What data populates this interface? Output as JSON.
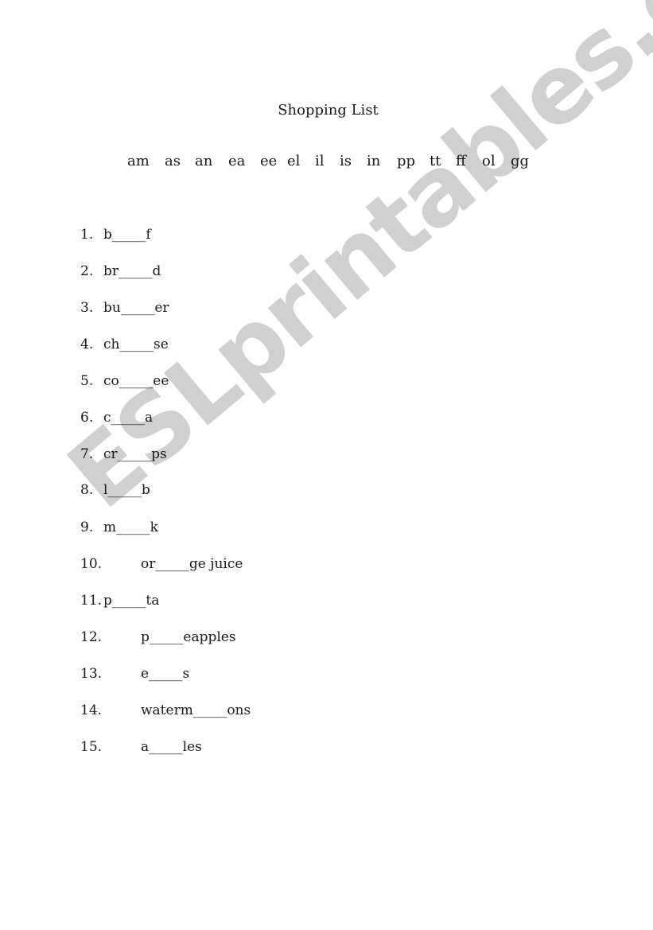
{
  "worksheet": {
    "title": "Shopping List",
    "letter_bank": [
      "am",
      "as",
      "an",
      "ea",
      "ee",
      "el",
      "il",
      "is",
      "in",
      "pp",
      "tt",
      "ff",
      "ol",
      "gg"
    ],
    "items": [
      {
        "num": "1.",
        "word": "b_____f"
      },
      {
        "num": "2.",
        "word": "br_____d"
      },
      {
        "num": "3.",
        "word": "bu_____er"
      },
      {
        "num": "4.",
        "word": "ch_____se"
      },
      {
        "num": "5.",
        "word": "co_____ee"
      },
      {
        "num": "6.",
        "word": "c_____a"
      },
      {
        "num": "7.",
        "word": "cr_____ps"
      },
      {
        "num": "8.",
        "word": "l_____b"
      },
      {
        "num": "9.",
        "word": "m_____k"
      },
      {
        "num": "10.",
        "word": "or_____ge juice"
      },
      {
        "num": "11.",
        "word": "p_____ta"
      },
      {
        "num": "12.",
        "word": "p_____eapples"
      },
      {
        "num": "13.",
        "word": "e_____s"
      },
      {
        "num": "14.",
        "word": "waterm_____ons"
      },
      {
        "num": "15.",
        "word": "a_____les"
      }
    ]
  },
  "watermark": {
    "text": "ESLprintables.com",
    "color": "#c8c8c8"
  }
}
